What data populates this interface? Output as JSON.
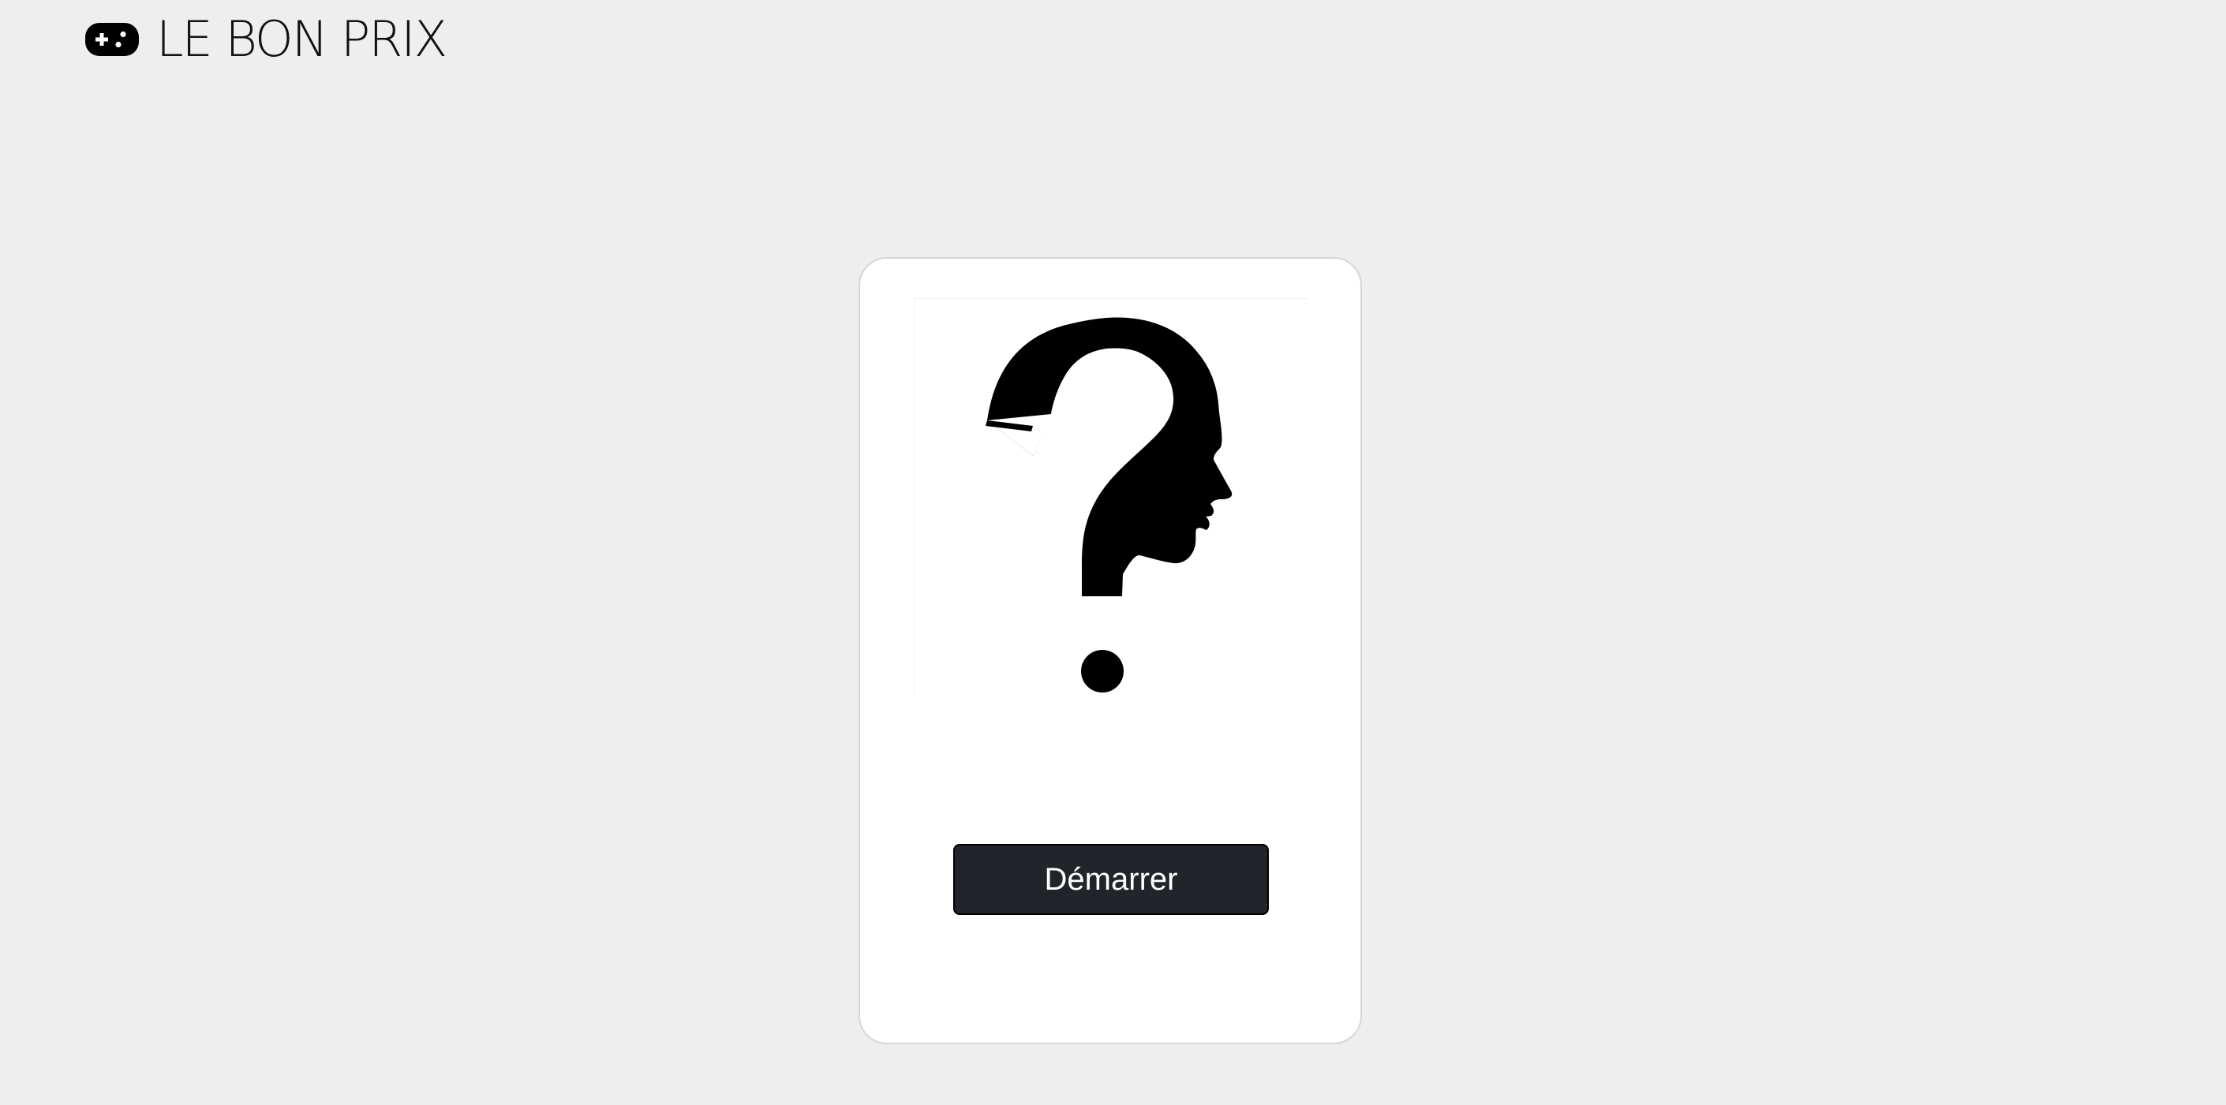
{
  "header": {
    "logo_icon": "gamepad-icon",
    "brand": "LE BON PRIX"
  },
  "card": {
    "image_icon": "question-mark-head-silhouette-icon",
    "start_label": "Démarrer"
  },
  "colors": {
    "page_background": "#eeeeee",
    "card_background": "#ffffff",
    "button_background": "#212529",
    "button_text": "#ffffff",
    "icon": "#000000"
  }
}
